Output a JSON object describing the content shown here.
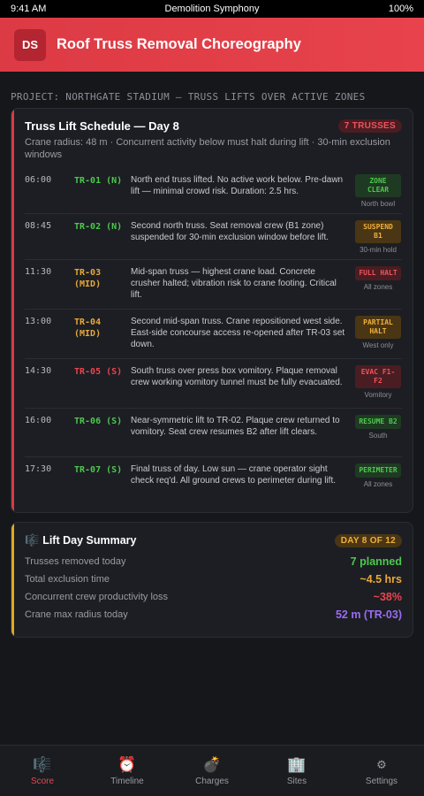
{
  "status": {
    "time": "9:41 AM",
    "carrier": "Demolition Symphony",
    "battery": "100%"
  },
  "app": {
    "logo": "DS",
    "title": "Roof Truss Removal Choreography"
  },
  "project_label": "PROJECT: NORTHGATE STADIUM — TRUSS LIFTS OVER ACTIVE ZONES",
  "schedule": {
    "title": "Truss Lift Schedule — Day 8",
    "count_badge": "7 TRUSSES",
    "subtitle": "Crane radius: 48 m · Concurrent activity below must halt during lift · 30-min exclusion windows",
    "rows": [
      {
        "time": "06:00",
        "code": "TR-01 (N)",
        "tone": "green",
        "desc": "North end truss lifted. No active work below. Pre-dawn lift — minimal crowd risk. Duration: 2.5 hrs.",
        "badge": "ZONE CLEAR",
        "badge_tone": "green",
        "loc": "North bowl"
      },
      {
        "time": "08:45",
        "code": "TR-02 (N)",
        "tone": "green",
        "desc": "Second north truss. Seat removal crew (B1 zone) suspended for 30-min exclusion window before lift.",
        "badge": "SUSPEND B1",
        "badge_tone": "gold",
        "loc": "30-min hold"
      },
      {
        "time": "11:30",
        "code": "TR-03 (MID)",
        "tone": "gold",
        "desc": "Mid-span truss — highest crane load. Concrete crusher halted; vibration risk to crane footing. Critical lift.",
        "badge": "FULL HALT",
        "badge_tone": "red",
        "loc": "All zones"
      },
      {
        "time": "13:00",
        "code": "TR-04 (MID)",
        "tone": "gold",
        "desc": "Second mid-span truss. Crane repositioned west side. East-side concourse access re-opened after TR-03 set down.",
        "badge": "PARTIAL HALT",
        "badge_tone": "gold",
        "loc": "West only"
      },
      {
        "time": "14:30",
        "code": "TR-05 (S)",
        "tone": "red",
        "desc": "South truss over press box vomitory. Plaque removal crew working vomitory tunnel must be fully evacuated.",
        "badge": "EVAC F1-F2",
        "badge_tone": "red",
        "loc": "Vomitory"
      },
      {
        "time": "16:00",
        "code": "TR-06 (S)",
        "tone": "green",
        "desc": "Near-symmetric lift to TR-02. Plaque crew returned to vomitory. Seat crew resumes B2 after lift clears.",
        "badge": "RESUME B2",
        "badge_tone": "green",
        "loc": "South"
      },
      {
        "time": "17:30",
        "code": "TR-07 (S)",
        "tone": "green",
        "desc": "Final truss of day. Low sun — crane operator sight check req'd. All ground crews to perimeter during lift.",
        "badge": "PERIMETER",
        "badge_tone": "green",
        "loc": "All zones"
      }
    ]
  },
  "summary": {
    "icon": "music-score-icon",
    "title": "Lift Day Summary",
    "day_badge": "DAY 8 OF 12",
    "rows": [
      {
        "label": "Trusses removed today",
        "value": "7 planned",
        "tone": "green"
      },
      {
        "label": "Total exclusion time",
        "value": "~4.5 hrs",
        "tone": "gold"
      },
      {
        "label": "Concurrent crew productivity loss",
        "value": "~38%",
        "tone": "red"
      },
      {
        "label": "Crane max radius today",
        "value": "52 m (TR-03)",
        "tone": "purple"
      }
    ]
  },
  "tabs": [
    {
      "label": "Score",
      "icon": "music-score-icon",
      "glyph": "🎼",
      "active": true
    },
    {
      "label": "Timeline",
      "icon": "alarm-clock-icon",
      "glyph": "⏰",
      "active": false
    },
    {
      "label": "Charges",
      "icon": "bomb-icon",
      "glyph": "💣",
      "active": false
    },
    {
      "label": "Sites",
      "icon": "building-icon",
      "glyph": "🏢",
      "active": false
    },
    {
      "label": "Settings",
      "icon": "gear-icon",
      "glyph": "⚙",
      "active": false
    }
  ],
  "colors": {
    "accent": "#e8434d",
    "green": "#4cc94c",
    "gold": "#e8a83a",
    "red": "#e8454e",
    "purple": "#9b6cf2"
  }
}
